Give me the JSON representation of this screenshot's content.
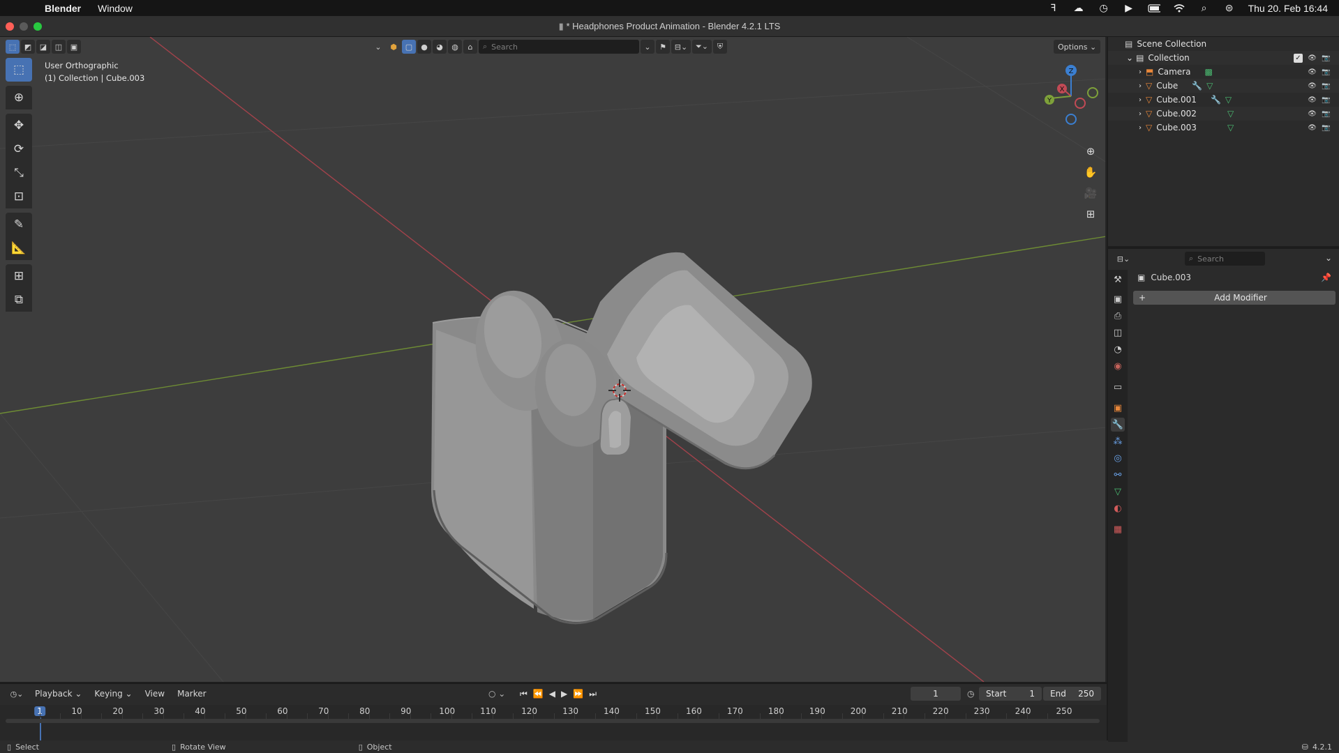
{
  "menubar": {
    "app": "Blender",
    "menus": [
      "Window"
    ],
    "clock": "Thu 20. Feb  16:44"
  },
  "window": {
    "title": "* Headphones Product Animation - Blender 4.2.1 LTS"
  },
  "viewport": {
    "view_name": "User Orthographic",
    "collection_info": "(1) Collection | Cube.003",
    "search_placeholder": "Search",
    "options_label": "Options",
    "gizmo_axes": [
      "Z",
      "X",
      "Y"
    ],
    "colors": {
      "x_axis": "#c24a55",
      "y_axis": "#7ea13a",
      "z_axis": "#3b7fd1",
      "active": "#4772b3",
      "background": "#3d3d3d"
    }
  },
  "outliner": {
    "root": "Scene Collection",
    "collection": "Collection",
    "items": [
      {
        "name": "Camera",
        "icon": "camera-icon"
      },
      {
        "name": "Cube",
        "icon": "mesh-icon"
      },
      {
        "name": "Cube.001",
        "icon": "mesh-icon"
      },
      {
        "name": "Cube.002",
        "icon": "mesh-icon"
      },
      {
        "name": "Cube.003",
        "icon": "mesh-icon"
      }
    ]
  },
  "properties": {
    "search_placeholder": "Search",
    "object_name": "Cube.003",
    "add_modifier_label": "Add Modifier"
  },
  "timeline": {
    "menus": [
      "Playback",
      "Keying",
      "View",
      "Marker"
    ],
    "current_frame": "1",
    "start_label": "Start",
    "start_value": "1",
    "end_label": "End",
    "end_value": "250",
    "ruler_labels": [
      "1",
      "10",
      "20",
      "30",
      "40",
      "50",
      "60",
      "70",
      "80",
      "90",
      "100",
      "110",
      "120",
      "130",
      "140",
      "150",
      "160",
      "170",
      "180",
      "190",
      "200",
      "210",
      "220",
      "230",
      "240",
      "250"
    ]
  },
  "statusbar": {
    "select": "Select",
    "rotate": "Rotate View",
    "object": "Object",
    "version": "4.2.1"
  }
}
